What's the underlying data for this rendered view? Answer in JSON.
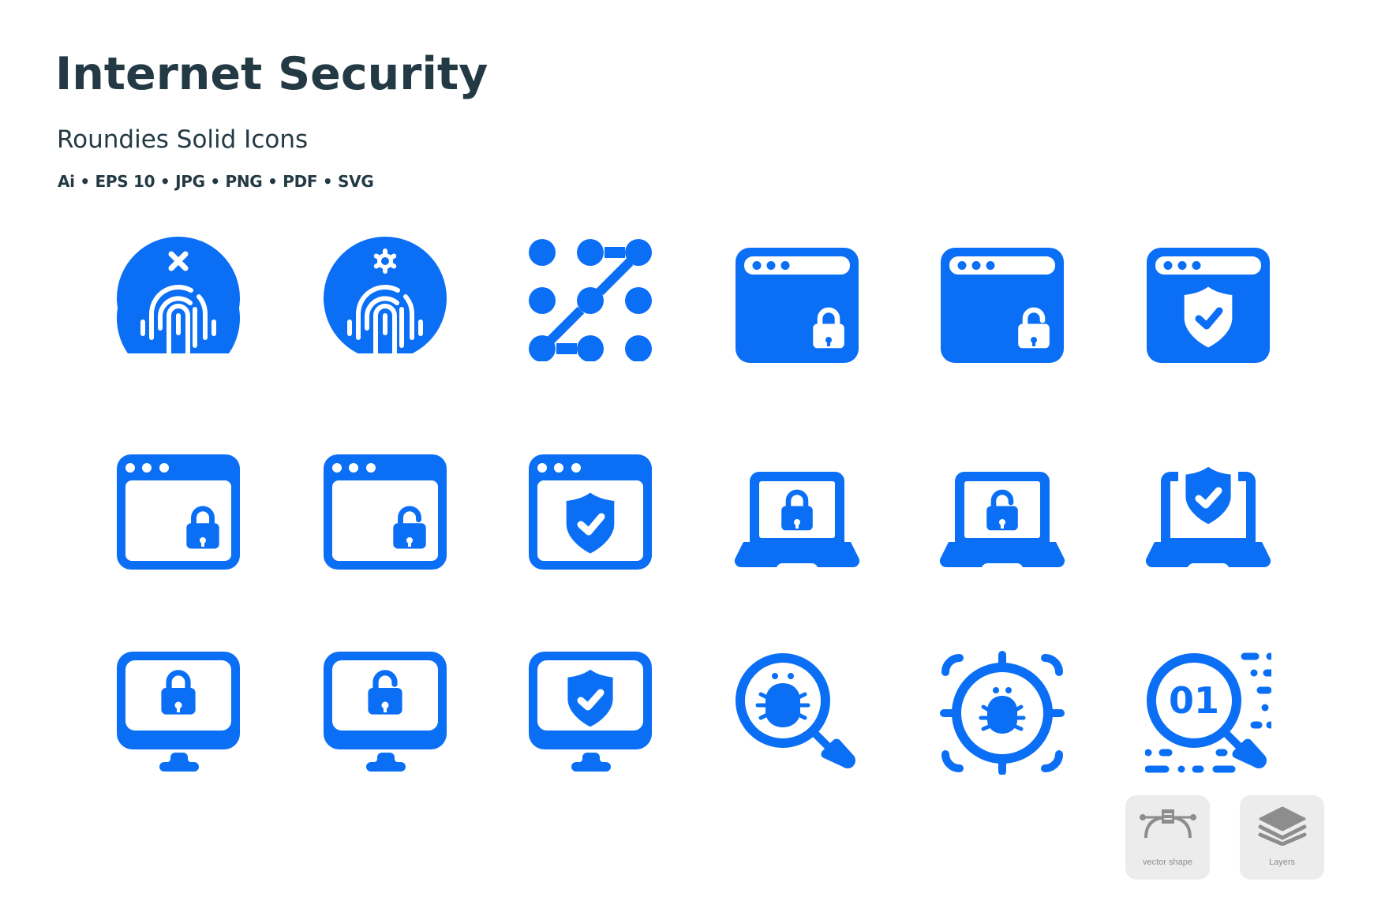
{
  "header": {
    "title": "Internet Security",
    "subtitle": "Roundies Solid Icons",
    "formats": "Ai • EPS 10 • JPG • PNG • PDF • SVG"
  },
  "colors": {
    "icon_blue": "#0b6ff6",
    "title_text": "#233a45",
    "badge_bg": "#ececec",
    "badge_icon": "#8d8d8d"
  },
  "icons": [
    {
      "row": 1,
      "name": "fingerprint-cross-icon"
    },
    {
      "row": 1,
      "name": "fingerprint-settings-icon"
    },
    {
      "row": 1,
      "name": "pattern-lock-icon"
    },
    {
      "row": 1,
      "name": "browser-locked-icon"
    },
    {
      "row": 1,
      "name": "browser-unlocked-icon"
    },
    {
      "row": 1,
      "name": "browser-shield-icon"
    },
    {
      "row": 2,
      "name": "browser-window-locked-icon"
    },
    {
      "row": 2,
      "name": "browser-window-unlocked-icon"
    },
    {
      "row": 2,
      "name": "browser-window-shield-icon"
    },
    {
      "row": 2,
      "name": "laptop-locked-icon"
    },
    {
      "row": 2,
      "name": "laptop-unlocked-icon"
    },
    {
      "row": 2,
      "name": "laptop-shield-icon"
    },
    {
      "row": 3,
      "name": "monitor-locked-icon"
    },
    {
      "row": 3,
      "name": "monitor-unlocked-icon"
    },
    {
      "row": 3,
      "name": "monitor-shield-icon"
    },
    {
      "row": 3,
      "name": "bug-search-icon"
    },
    {
      "row": 3,
      "name": "bug-target-icon"
    },
    {
      "row": 3,
      "name": "binary-search-icon",
      "text": "01"
    }
  ],
  "badges": [
    {
      "label": "vector shape",
      "icon": "bezier-pen-icon"
    },
    {
      "label": "Layers",
      "icon": "layers-icon"
    }
  ]
}
